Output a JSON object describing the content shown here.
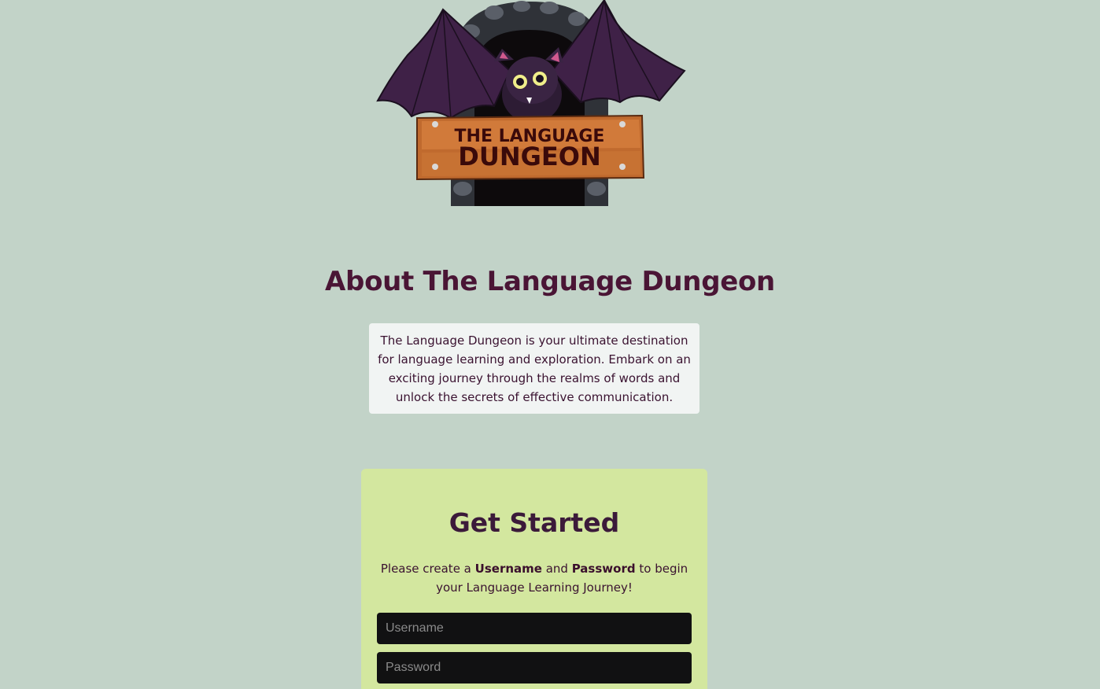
{
  "logo": {
    "line1": "THE LANGUAGE",
    "line2": "DUNGEON"
  },
  "about": {
    "title": "About The Language Dungeon",
    "description": "The Language Dungeon is your ultimate destination for language learning and exploration. Embark on an exciting journey through the realms of words and unlock the secrets of effective communication."
  },
  "get_started": {
    "title": "Get Started",
    "intro_prefix": "Please create a ",
    "intro_username": "Username",
    "intro_and": " and ",
    "intro_password": "Password",
    "intro_suffix": " to begin your Language Learning Journey!",
    "username_placeholder": "Username",
    "password_placeholder": "Password"
  },
  "colors": {
    "background": "#c2d3c8",
    "heading": "#4a1535",
    "card": "#d3e79f",
    "input": "#111112"
  }
}
